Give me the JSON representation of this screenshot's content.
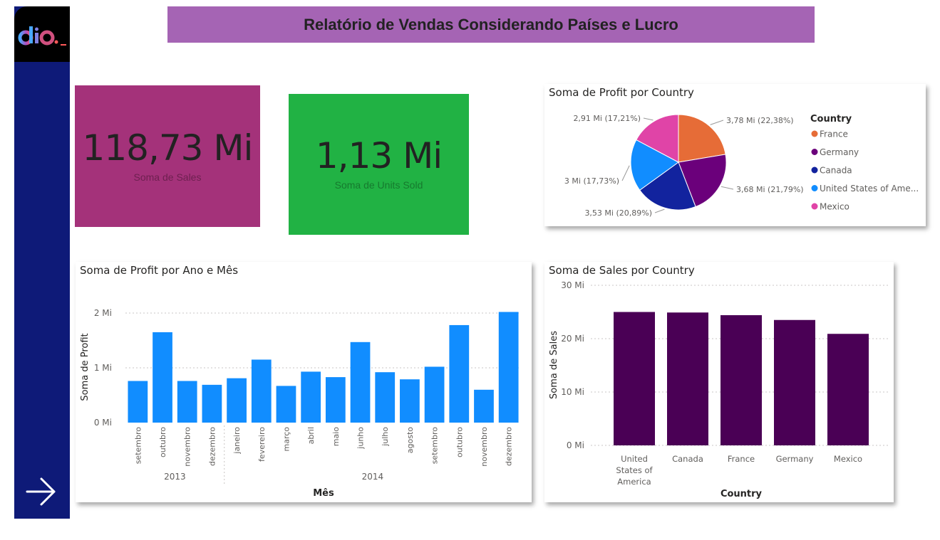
{
  "report": {
    "title": "Relatório de Vendas Considerando Países e Lucro"
  },
  "colors": {
    "sidebar": "#0e1a78",
    "title_bg": "#a564b4",
    "sales_card": "#a4327a",
    "units_card": "#21b244",
    "bar_blue": "#118dff",
    "bar_purple": "#4a0055"
  },
  "icons": {
    "logo": "dio-logo",
    "nav": "arrow-right-icon"
  },
  "cards": {
    "sales": {
      "value": "118,73 Mi",
      "label": "Soma de Sales"
    },
    "units": {
      "value": "1,13 Mi",
      "label": "Soma de Units Sold"
    }
  },
  "chart_data": [
    {
      "type": "pie",
      "title": "Soma de Profit por Country",
      "legend_title": "Country",
      "legend_position": "right",
      "slices": [
        {
          "name": "France",
          "label": "France",
          "value": 3.78,
          "data_label": "3,78 Mi (22,38%)",
          "color": "#e66c37"
        },
        {
          "name": "Germany",
          "label": "Germany",
          "value": 3.68,
          "data_label": "3,68 Mi (21,79%)",
          "color": "#6b007b"
        },
        {
          "name": "Canada",
          "label": "Canada",
          "value": 3.53,
          "data_label": "3,53 Mi (20,89%)",
          "color": "#12239e"
        },
        {
          "name": "United States of America",
          "label": "United States of Ame...",
          "value": 3.0,
          "data_label": "3 Mi (17,73%)",
          "color": "#118dff"
        },
        {
          "name": "Mexico",
          "label": "Mexico",
          "value": 2.91,
          "data_label": "2,91 Mi (17,21%)",
          "color": "#e044a7"
        }
      ]
    },
    {
      "type": "bar",
      "title": "Soma de Profit por Ano e Mês",
      "xlabel": "Mês",
      "ylabel": "Soma de Profit",
      "ylim": [
        0,
        2.2
      ],
      "yticks": [
        {
          "value": 0,
          "label": "0 Mi"
        },
        {
          "value": 1,
          "label": "1 Mi"
        },
        {
          "value": 2,
          "label": "2 Mi"
        }
      ],
      "grid": true,
      "categories": [
        "setembro",
        "outubro",
        "novembro",
        "dezembro",
        "janeiro",
        "fevereiro",
        "março",
        "abril",
        "maio",
        "junho",
        "julho",
        "agosto",
        "setembro",
        "outubro",
        "novembro",
        "dezembro"
      ],
      "groups": [
        {
          "label": "2013",
          "count": 4
        },
        {
          "label": "2014",
          "count": 12
        }
      ],
      "values": [
        0.76,
        1.65,
        0.76,
        0.69,
        0.81,
        1.15,
        0.67,
        0.93,
        0.83,
        1.47,
        0.92,
        0.79,
        1.02,
        1.78,
        0.6,
        2.02
      ],
      "color": "#118dff"
    },
    {
      "type": "bar",
      "title": "Soma de Sales por Country",
      "xlabel": "Country",
      "ylabel": "Soma de Sales",
      "ylim": [
        0,
        30
      ],
      "yticks": [
        {
          "value": 0,
          "label": "0 Mi"
        },
        {
          "value": 10,
          "label": "10 Mi"
        },
        {
          "value": 20,
          "label": "20 Mi"
        },
        {
          "value": 30,
          "label": "30 Mi"
        }
      ],
      "grid": true,
      "categories": [
        "United States of America",
        "Canada",
        "France",
        "Germany",
        "Mexico"
      ],
      "values": [
        25.0,
        24.9,
        24.4,
        23.5,
        20.9
      ],
      "color": "#4a0055"
    }
  ]
}
